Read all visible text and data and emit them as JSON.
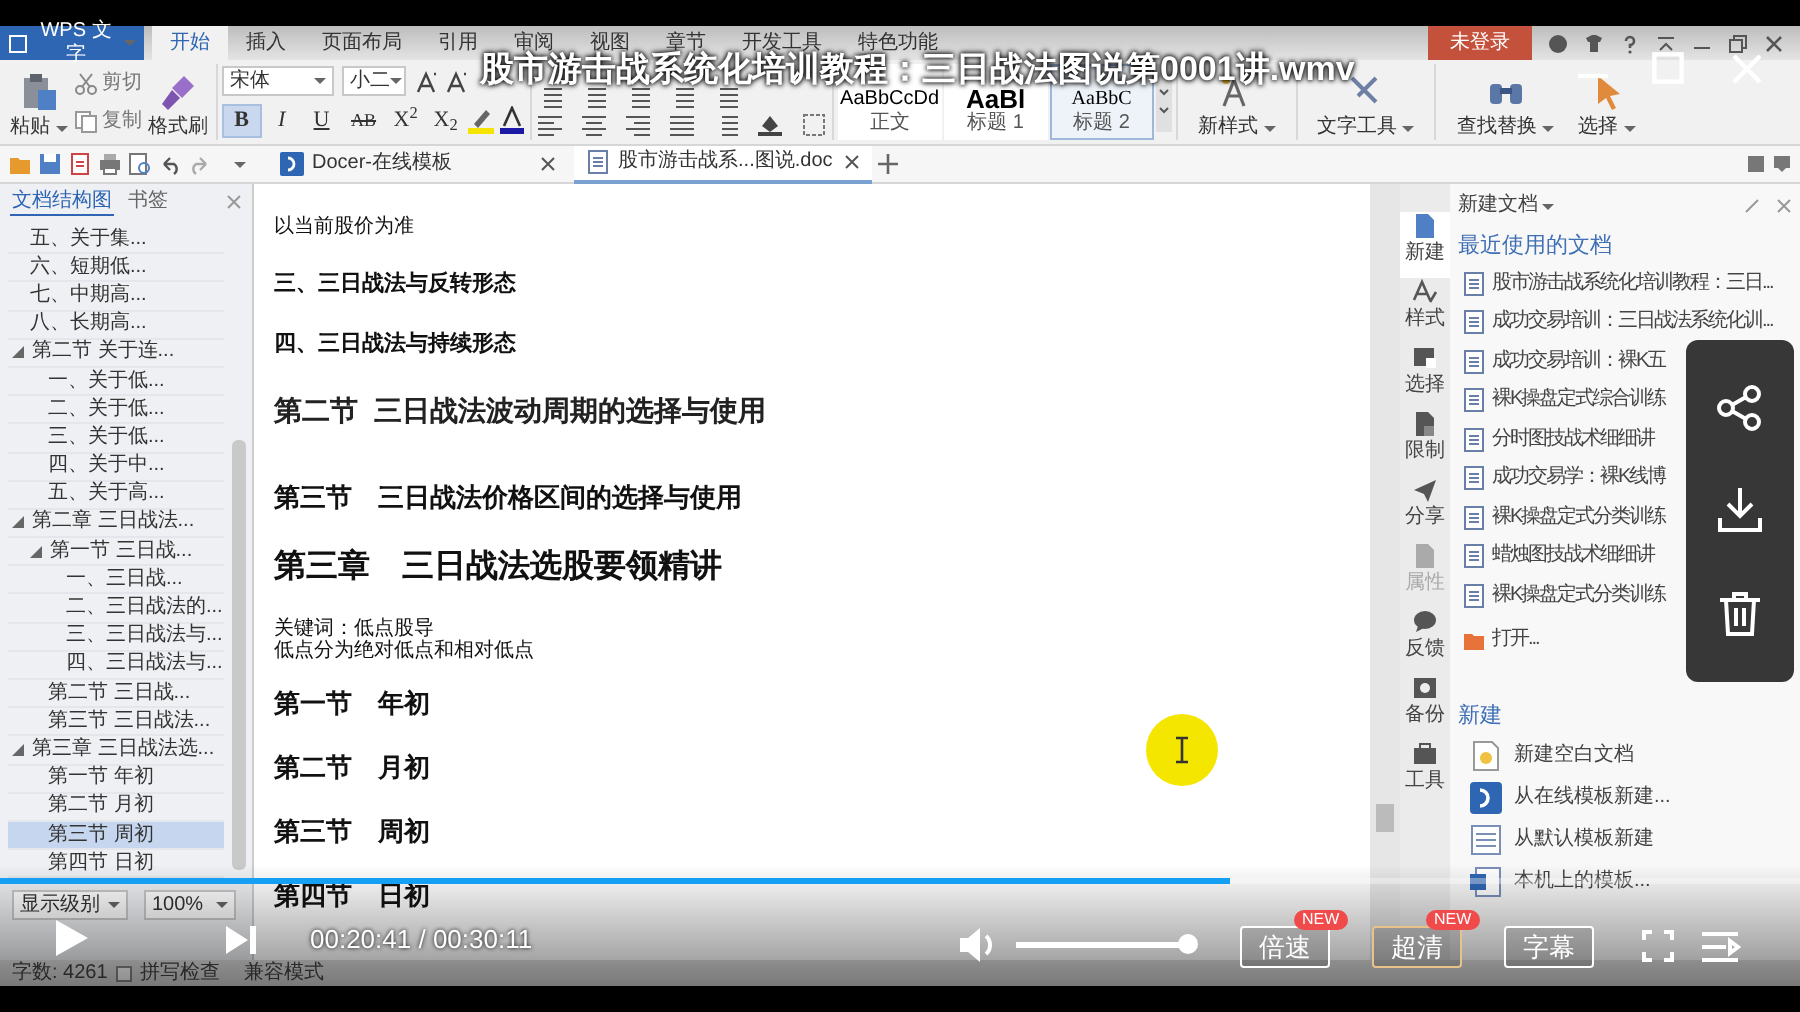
{
  "player": {
    "title": "股市游击战系统化培训教程：三日战法图说第0001讲.wmv",
    "progress": {
      "level": 0.683
    },
    "time": "00:20:41 / 00:30:11",
    "volume": {
      "level": 1
    },
    "buttons": [
      {
        "label": "倍速",
        "badge": "NEW",
        "selected": false
      },
      {
        "label": "超清",
        "badge": "NEW",
        "selected": true
      },
      {
        "label": "字幕",
        "selected": false
      }
    ]
  },
  "app": {
    "menu_button": "WPS 文字",
    "ribbon_tabs": [
      {
        "label": "开始",
        "selected": true
      },
      {
        "label": "插入",
        "selected": false
      },
      {
        "label": "页面布局",
        "selected": false
      },
      {
        "label": "引用",
        "selected": false
      },
      {
        "label": "审阅",
        "selected": false
      },
      {
        "label": "视图",
        "selected": false
      },
      {
        "label": "章节",
        "selected": false
      },
      {
        "label": "开发工具",
        "selected": false
      },
      {
        "label": "特色功能",
        "selected": false
      }
    ],
    "login_button": "未登录",
    "ribbon": {
      "clipboard": [
        {
          "kind": "paste",
          "label": "粘贴"
        },
        {
          "kind": "cut",
          "label": "剪切"
        },
        {
          "kind": "copy",
          "label": "复制"
        },
        {
          "kind": "painter",
          "label": "格式刷"
        }
      ],
      "font": "宋体",
      "font_size": "小二",
      "format_buttons": [
        {
          "label": "B",
          "selected": true
        },
        {
          "label": "I",
          "selected": false
        },
        {
          "label": "U",
          "selected": false
        },
        {
          "label": "AB",
          "selected": false
        },
        {
          "label": "X$^{2}$",
          "selected": false
        },
        {
          "label": "X$_{2}$",
          "selected": false
        }
      ],
      "styles": [
        {
          "sample": "AaBbCcDd",
          "label": "正文",
          "selected": false
        },
        {
          "sample": "AaBl",
          "label": "标题 1",
          "selected": false
        },
        {
          "sample": "AaBbC",
          "label": "标题 2",
          "selected": true
        }
      ],
      "tools": [
        {
          "kind": "style",
          "label": "新样式"
        },
        {
          "kind": "text",
          "label": "文字工具"
        },
        {
          "kind": "find",
          "label": "查找替换"
        },
        {
          "kind": "select",
          "label": "选择"
        }
      ]
    },
    "doc_tabs": [
      {
        "label": "Docer-在线模板",
        "selected": false
      },
      {
        "label": "股市游击战系...图说.doc",
        "selected": true
      }
    ],
    "navigation": {
      "tabs": [
        {
          "label": "文档结构图",
          "selected": true
        },
        {
          "label": "书签",
          "selected": false
        }
      ],
      "tree": [
        {
          "label": "五、关于集...",
          "selected": false
        },
        {
          "label": "六、短期低...",
          "selected": false
        },
        {
          "label": "七、中期高...",
          "selected": false
        },
        {
          "label": "八、长期高...",
          "selected": false
        },
        {
          "label": "第二节 关于连...",
          "selected": false,
          "expanded": true,
          "children": [
            {
              "label": "一、关于低...",
              "selected": false
            },
            {
              "label": "二、关于低...",
              "selected": false
            },
            {
              "label": "三、关于低...",
              "selected": false
            },
            {
              "label": "四、关于中...",
              "selected": false
            },
            {
              "label": "五、关于高...",
              "selected": false
            }
          ]
        },
        {
          "label": "第二章  三日战法...",
          "selected": false,
          "expanded": true,
          "children": [
            {
              "label": "第一节  三日战...",
              "selected": false,
              "expanded": true,
              "children": [
                {
                  "label": "一、三日战...",
                  "selected": false
                },
                {
                  "label": "二、三日战法的...",
                  "selected": false
                },
                {
                  "label": "三、三日战法与...",
                  "selected": false
                },
                {
                  "label": "四、三日战法与...",
                  "selected": false
                }
              ]
            },
            {
              "label": "第二节  三日战...",
              "selected": false
            },
            {
              "label": "第三节  三日战法...",
              "selected": false
            }
          ]
        },
        {
          "label": "第三章  三日战法选...",
          "selected": false,
          "expanded": true,
          "children": [
            {
              "label": "第一节  年初",
              "selected": false
            },
            {
              "label": "第二节  月初",
              "selected": false
            },
            {
              "label": "第三节  周初",
              "selected": true
            },
            {
              "label": "第四节  日初",
              "selected": false
            }
          ]
        }
      ],
      "level_select": "显示级别",
      "zoom_select": "100%"
    },
    "document": [
      {
        "kind": "note",
        "text": "以当前股价为准"
      },
      {
        "kind": "subheading",
        "text": "三、三日战法与反转形态"
      },
      {
        "kind": "subheading",
        "text": "四、三日战法与持续形态"
      },
      {
        "kind": "section_sans",
        "text": "第二节  三日战法波动周期的选择与使用"
      },
      {
        "kind": "section",
        "text": "第三节    三日战法价格区间的选择与使用"
      },
      {
        "kind": "chapter",
        "text": "第三章    三日战法选股要领精讲"
      },
      {
        "kind": "note",
        "text": "关键词：低点股导"
      },
      {
        "kind": "note",
        "text": "低点分为绝对低点和相对低点"
      },
      {
        "kind": "section",
        "text": "第一节    年初"
      },
      {
        "kind": "section",
        "text": "第二节    月初"
      },
      {
        "kind": "section",
        "text": "第三节    周初"
      },
      {
        "kind": "section",
        "text": "第四节    日初"
      }
    ],
    "side_strip": [
      {
        "kind": "new",
        "label": "新建",
        "selected": true,
        "disabled": false
      },
      {
        "kind": "style",
        "label": "样式",
        "selected": false,
        "disabled": false
      },
      {
        "kind": "select",
        "label": "选择",
        "selected": false,
        "disabled": false
      },
      {
        "kind": "restrict",
        "label": "限制",
        "selected": false,
        "disabled": false
      },
      {
        "kind": "share",
        "label": "分享",
        "selected": false,
        "disabled": false
      },
      {
        "kind": "properties",
        "label": "属性",
        "selected": false,
        "disabled": true
      },
      {
        "kind": "feedback",
        "label": "反馈",
        "selected": false,
        "disabled": false
      },
      {
        "kind": "backup",
        "label": "备份",
        "selected": false,
        "disabled": false
      },
      {
        "kind": "tools",
        "label": "工具",
        "selected": false,
        "disabled": false
      }
    ],
    "task_pane": {
      "title": "新建文档",
      "recent_heading": "最近使用的文档",
      "recent": [
        "股市游击战系统化培训教程：三日...",
        "成功交易培训：三日战法系统化训...",
        "成功交易培训：裸K五",
        "裸K操盘定式综合训练",
        "分时图技战术细细讲",
        "成功交易学：裸K线博",
        "裸K操盘定式分类训练",
        "蜡烛图技战术细细讲",
        "裸K操盘定式分类训练"
      ],
      "open": "打开...",
      "new_heading": "新建",
      "new_items": [
        {
          "kind": "blank",
          "label": "新建空白文档"
        },
        {
          "kind": "online",
          "label": "从在线模板新建..."
        },
        {
          "kind": "default",
          "label": "从默认模板新建"
        },
        {
          "kind": "local",
          "label": "本机上的模板..."
        }
      ]
    },
    "status_bar": {
      "word_count": "字数: 4261",
      "spell_check": {
        "label": "拼写检查",
        "checked": false
      },
      "mode": "兼容模式"
    }
  }
}
